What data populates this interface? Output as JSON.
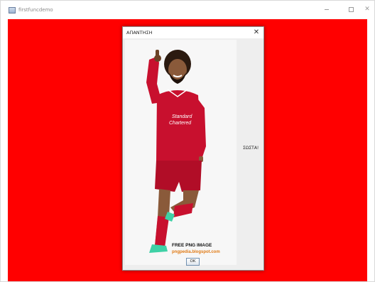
{
  "window": {
    "title": "firstfuncdemo",
    "background_color": "#ff0000"
  },
  "dialog": {
    "title": "ΑΠΑΝΤΗΣΗ",
    "message": "ΣΩΣΤΑ!",
    "ok_label": "OK",
    "image": {
      "watermark_line1": "FREE PNG IMAGE",
      "watermark_line2": "pngpedia.blogspot.com",
      "shirt_sponsor": "Standard Chartered"
    }
  },
  "icons": {
    "app": "java-app-icon",
    "minimize": "minimize-icon",
    "maximize": "maximize-icon",
    "close": "close-icon"
  }
}
